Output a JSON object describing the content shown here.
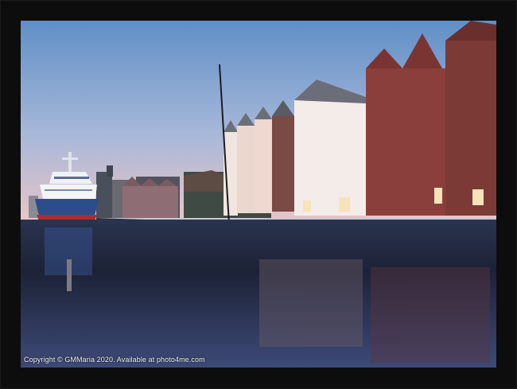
{
  "image": {
    "description_colors": {
      "frame": "#0d0d0d",
      "sky_top": "#5f8fc6",
      "sky_bottom": "#e9c4c4",
      "water": "#14182a"
    },
    "copyright_text": "Copyright  ©  GMMaria  2020. Available at photo4me.com"
  }
}
